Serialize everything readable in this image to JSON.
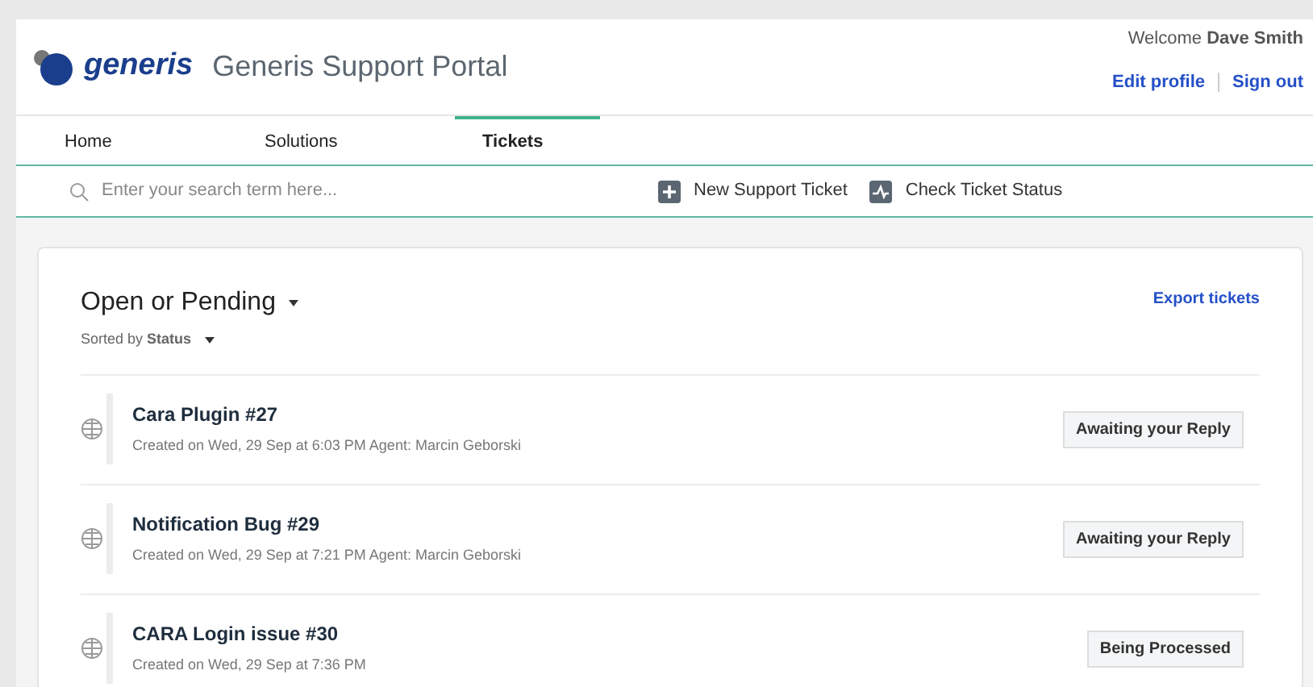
{
  "header": {
    "logo_text": "generis",
    "title": "Generis Support Portal",
    "welcome": "Welcome **Dave Smith**",
    "links": [
      "Edit profile",
      "Sign out"
    ]
  },
  "tabs": [
    {
      "label": "Home",
      "selected": false
    },
    {
      "label": "Solutions",
      "selected": false
    },
    {
      "label": "Tickets",
      "selected": true
    }
  ],
  "toolbar": {
    "search": {
      "placeholder": "Enter your search term here..."
    },
    "actions": [
      {
        "kind": "new",
        "label": "New Support Ticket"
      },
      {
        "kind": "status",
        "label": "Check Ticket Status"
      }
    ]
  },
  "list": {
    "title": "Open or Pending",
    "sort": "Sorted by **Status**",
    "export": "Export tickets",
    "tickets": [
      {
        "title": "Cara Plugin #27",
        "meta": "Created on Wed, 29 Sep at 6:03 PM Agent: Marcin Geborski",
        "status": "Awaiting your Reply"
      },
      {
        "title": "Notification Bug #29",
        "meta": "Created on Wed, 29 Sep at 7:21 PM Agent: Marcin Geborski",
        "status": "Awaiting your Reply"
      },
      {
        "title": "CARA Login issue #30",
        "meta": "Created on Wed, 29 Sep at 7:36 PM",
        "status": "Being Processed"
      }
    ]
  }
}
